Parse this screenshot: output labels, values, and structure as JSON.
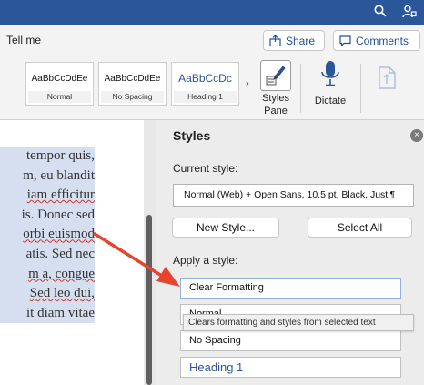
{
  "window": {
    "search_icon": "search-icon",
    "account_icon": "account-icon"
  },
  "ribbon_top": {
    "tell_me": "Tell me",
    "share_label": "Share",
    "comments_label": "Comments"
  },
  "style_gallery": [
    {
      "sample": "AaBbCcDdEe",
      "name": "Normal"
    },
    {
      "sample": "AaBbCcDdEe",
      "name": "No Spacing"
    },
    {
      "sample": "AaBbCcDc",
      "name": "Heading 1"
    }
  ],
  "ribbon": {
    "gallery_more": "›",
    "styles_pane_line1": "Styles",
    "styles_pane_line2": "Pane",
    "dictate_label": "Dictate"
  },
  "document": {
    "lines": [
      {
        "text": "tempor quis,",
        "misspelled": false
      },
      {
        "text": "m, eu blandit",
        "misspelled": false
      },
      {
        "text": "iam efficitur",
        "misspelled": true
      },
      {
        "text": "is. Donec sed",
        "misspelled": false
      },
      {
        "text": "orbi euismod",
        "misspelled": true
      },
      {
        "text": "atis. Sed nec",
        "misspelled": false
      },
      {
        "text": "m a, congue",
        "misspelled": true
      },
      {
        "text": "Sed leo dui,",
        "misspelled": true
      },
      {
        "text": "it diam vitae",
        "misspelled": false
      }
    ]
  },
  "styles_pane": {
    "title": "Styles",
    "close_glyph": "×",
    "current_style_label": "Current style:",
    "current_style_value": "Normal (Web) + Open Sans, 10.5 pt, Black, Justi¶",
    "new_style_label": "New Style...",
    "select_all_label": "Select All",
    "apply_label": "Apply a style:",
    "styles": [
      {
        "name": "Clear Formatting"
      },
      {
        "name": "Normal"
      },
      {
        "name": "No Spacing"
      },
      {
        "name": "Heading 1"
      }
    ],
    "tooltip": "Clears formatting and styles from selected text"
  },
  "colors": {
    "title_bar": "#2b579a",
    "accent": "#1f4e9c",
    "arrow": "#e8442c",
    "selection": "#d5dff0"
  }
}
